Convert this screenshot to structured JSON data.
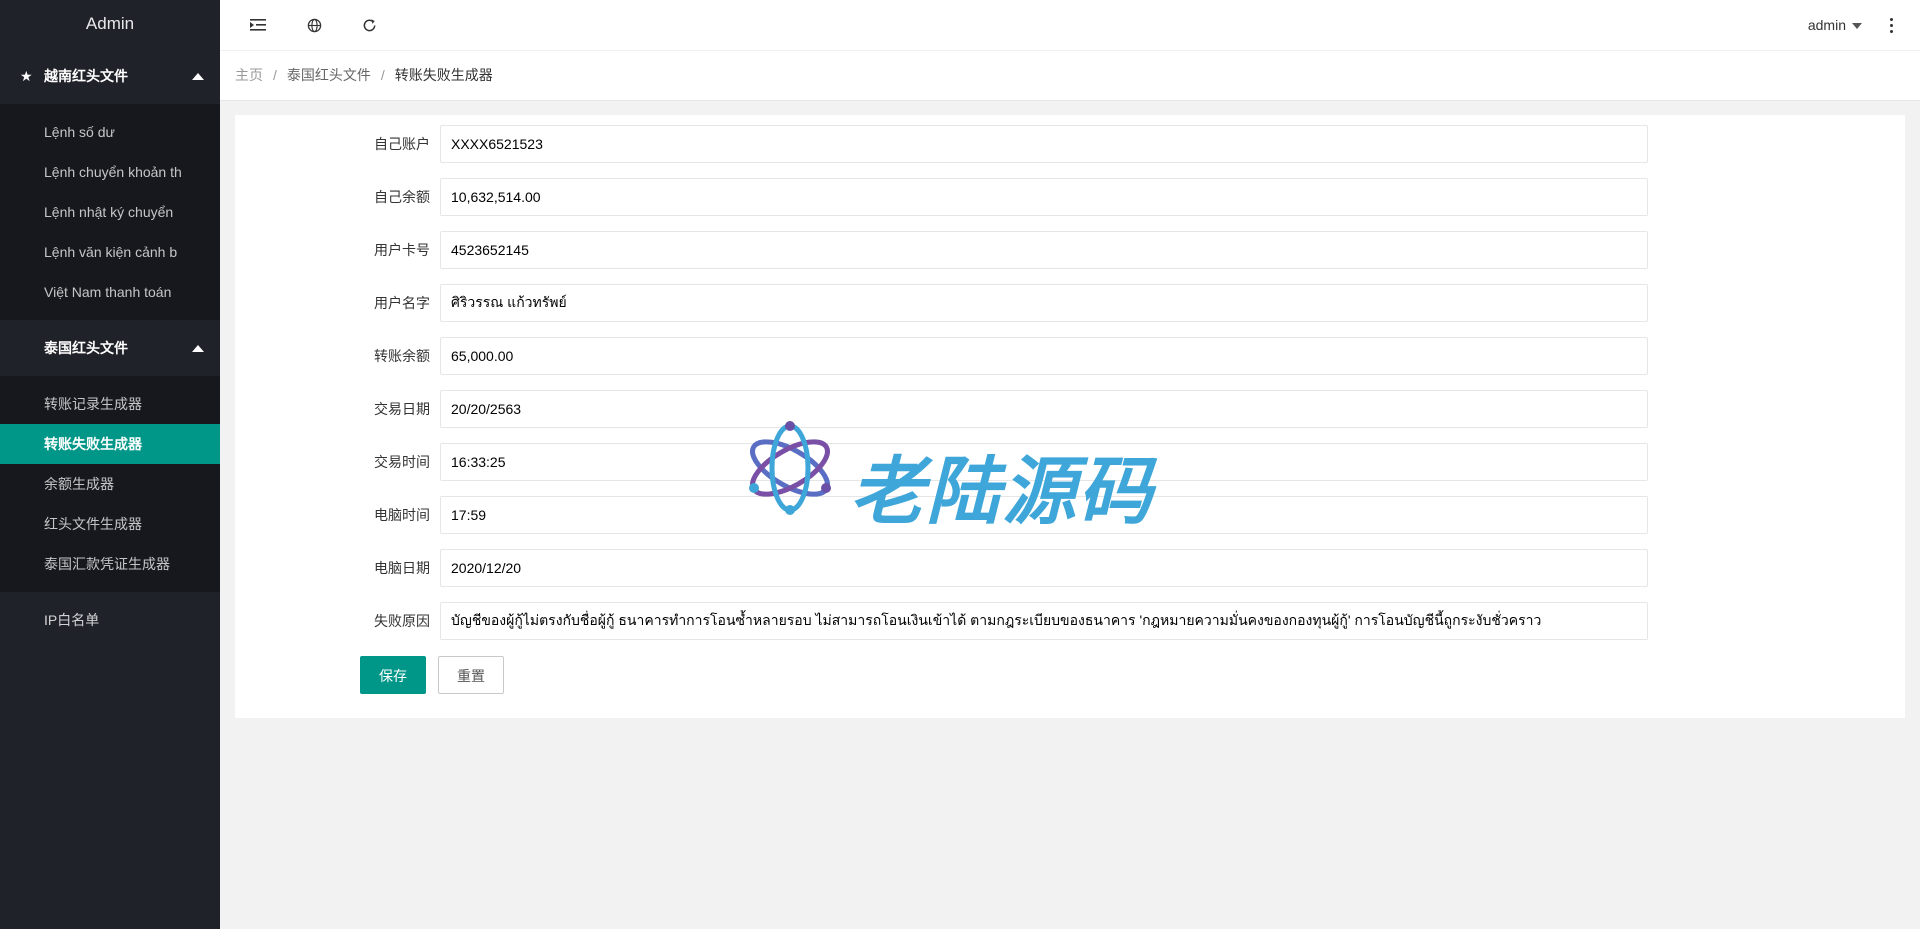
{
  "sidebar": {
    "logo": "Admin",
    "groups": [
      {
        "title": "越南红头文件",
        "items": [
          "Lệnh số dư",
          "Lệnh chuyển khoản th",
          "Lệnh nhật ký chuyển",
          "Lệnh văn kiện cảnh b",
          "Việt Nam thanh toán"
        ]
      },
      {
        "title": "泰国红头文件",
        "items": [
          "转账记录生成器",
          "转账失败生成器",
          "余额生成器",
          "红头文件生成器",
          "泰国汇款凭证生成器"
        ]
      }
    ],
    "single": "IP白名单"
  },
  "header": {
    "user": "admin"
  },
  "breadcrumb": {
    "home": "主页",
    "parent": "泰国红头文件",
    "current": "转账失败生成器",
    "separator": "/"
  },
  "form": {
    "fields": [
      {
        "label": "自己账户",
        "value": "XXXX6521523"
      },
      {
        "label": "自己余额",
        "value": "10,632,514.00"
      },
      {
        "label": "用户卡号",
        "value": "4523652145"
      },
      {
        "label": "用户名字",
        "value": "ศิริวรรณ แก้วทรัพย์"
      },
      {
        "label": "转账余额",
        "value": "65,000.00"
      },
      {
        "label": "交易日期",
        "value": "20/20/2563"
      },
      {
        "label": "交易时间",
        "value": "16:33:25"
      },
      {
        "label": "电脑时间",
        "value": "17:59"
      },
      {
        "label": "电脑日期",
        "value": "2020/12/20"
      },
      {
        "label": "失败原因",
        "value": "บัญชีของผู้กู้ไม่ตรงกับชื่อผู้กู้ ธนาคารทำการโอนซ้ำหลายรอบ ไม่สามารถโอนเงินเข้าได้ ตามกฎระเบียบของธนาคาร 'กฎหมายความมั่นคงของกองทุนผู้กู้' การโอนบัญชีนี้ถูกระงับชั่วคราว"
      }
    ],
    "save_label": "保存",
    "reset_label": "重置"
  },
  "watermark": {
    "text": "老陆源码"
  },
  "colors": {
    "accent": "#009688",
    "sidebar_bg": "#20222a",
    "sidebar_child_bg": "#16181d"
  }
}
